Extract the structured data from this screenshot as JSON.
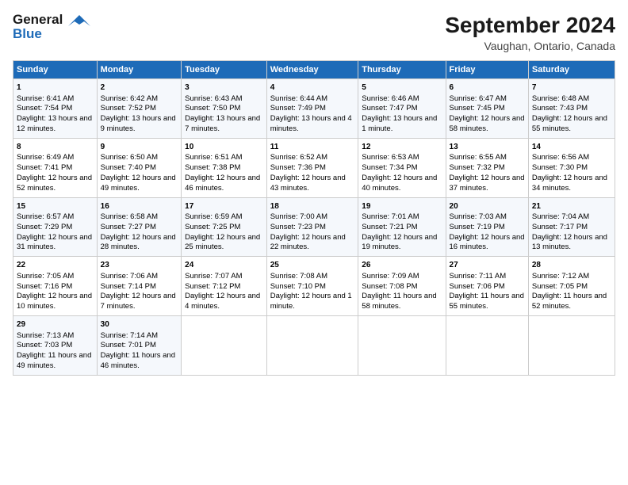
{
  "logo": {
    "line1": "General",
    "line2": "Blue"
  },
  "title": "September 2024",
  "subtitle": "Vaughan, Ontario, Canada",
  "headers": [
    "Sunday",
    "Monday",
    "Tuesday",
    "Wednesday",
    "Thursday",
    "Friday",
    "Saturday"
  ],
  "weeks": [
    [
      {
        "day": "1",
        "sunrise": "Sunrise: 6:41 AM",
        "sunset": "Sunset: 7:54 PM",
        "daylight": "Daylight: 13 hours and 12 minutes."
      },
      {
        "day": "2",
        "sunrise": "Sunrise: 6:42 AM",
        "sunset": "Sunset: 7:52 PM",
        "daylight": "Daylight: 13 hours and 9 minutes."
      },
      {
        "day": "3",
        "sunrise": "Sunrise: 6:43 AM",
        "sunset": "Sunset: 7:50 PM",
        "daylight": "Daylight: 13 hours and 7 minutes."
      },
      {
        "day": "4",
        "sunrise": "Sunrise: 6:44 AM",
        "sunset": "Sunset: 7:49 PM",
        "daylight": "Daylight: 13 hours and 4 minutes."
      },
      {
        "day": "5",
        "sunrise": "Sunrise: 6:46 AM",
        "sunset": "Sunset: 7:47 PM",
        "daylight": "Daylight: 13 hours and 1 minute."
      },
      {
        "day": "6",
        "sunrise": "Sunrise: 6:47 AM",
        "sunset": "Sunset: 7:45 PM",
        "daylight": "Daylight: 12 hours and 58 minutes."
      },
      {
        "day": "7",
        "sunrise": "Sunrise: 6:48 AM",
        "sunset": "Sunset: 7:43 PM",
        "daylight": "Daylight: 12 hours and 55 minutes."
      }
    ],
    [
      {
        "day": "8",
        "sunrise": "Sunrise: 6:49 AM",
        "sunset": "Sunset: 7:41 PM",
        "daylight": "Daylight: 12 hours and 52 minutes."
      },
      {
        "day": "9",
        "sunrise": "Sunrise: 6:50 AM",
        "sunset": "Sunset: 7:40 PM",
        "daylight": "Daylight: 12 hours and 49 minutes."
      },
      {
        "day": "10",
        "sunrise": "Sunrise: 6:51 AM",
        "sunset": "Sunset: 7:38 PM",
        "daylight": "Daylight: 12 hours and 46 minutes."
      },
      {
        "day": "11",
        "sunrise": "Sunrise: 6:52 AM",
        "sunset": "Sunset: 7:36 PM",
        "daylight": "Daylight: 12 hours and 43 minutes."
      },
      {
        "day": "12",
        "sunrise": "Sunrise: 6:53 AM",
        "sunset": "Sunset: 7:34 PM",
        "daylight": "Daylight: 12 hours and 40 minutes."
      },
      {
        "day": "13",
        "sunrise": "Sunrise: 6:55 AM",
        "sunset": "Sunset: 7:32 PM",
        "daylight": "Daylight: 12 hours and 37 minutes."
      },
      {
        "day": "14",
        "sunrise": "Sunrise: 6:56 AM",
        "sunset": "Sunset: 7:30 PM",
        "daylight": "Daylight: 12 hours and 34 minutes."
      }
    ],
    [
      {
        "day": "15",
        "sunrise": "Sunrise: 6:57 AM",
        "sunset": "Sunset: 7:29 PM",
        "daylight": "Daylight: 12 hours and 31 minutes."
      },
      {
        "day": "16",
        "sunrise": "Sunrise: 6:58 AM",
        "sunset": "Sunset: 7:27 PM",
        "daylight": "Daylight: 12 hours and 28 minutes."
      },
      {
        "day": "17",
        "sunrise": "Sunrise: 6:59 AM",
        "sunset": "Sunset: 7:25 PM",
        "daylight": "Daylight: 12 hours and 25 minutes."
      },
      {
        "day": "18",
        "sunrise": "Sunrise: 7:00 AM",
        "sunset": "Sunset: 7:23 PM",
        "daylight": "Daylight: 12 hours and 22 minutes."
      },
      {
        "day": "19",
        "sunrise": "Sunrise: 7:01 AM",
        "sunset": "Sunset: 7:21 PM",
        "daylight": "Daylight: 12 hours and 19 minutes."
      },
      {
        "day": "20",
        "sunrise": "Sunrise: 7:03 AM",
        "sunset": "Sunset: 7:19 PM",
        "daylight": "Daylight: 12 hours and 16 minutes."
      },
      {
        "day": "21",
        "sunrise": "Sunrise: 7:04 AM",
        "sunset": "Sunset: 7:17 PM",
        "daylight": "Daylight: 12 hours and 13 minutes."
      }
    ],
    [
      {
        "day": "22",
        "sunrise": "Sunrise: 7:05 AM",
        "sunset": "Sunset: 7:16 PM",
        "daylight": "Daylight: 12 hours and 10 minutes."
      },
      {
        "day": "23",
        "sunrise": "Sunrise: 7:06 AM",
        "sunset": "Sunset: 7:14 PM",
        "daylight": "Daylight: 12 hours and 7 minutes."
      },
      {
        "day": "24",
        "sunrise": "Sunrise: 7:07 AM",
        "sunset": "Sunset: 7:12 PM",
        "daylight": "Daylight: 12 hours and 4 minutes."
      },
      {
        "day": "25",
        "sunrise": "Sunrise: 7:08 AM",
        "sunset": "Sunset: 7:10 PM",
        "daylight": "Daylight: 12 hours and 1 minute."
      },
      {
        "day": "26",
        "sunrise": "Sunrise: 7:09 AM",
        "sunset": "Sunset: 7:08 PM",
        "daylight": "Daylight: 11 hours and 58 minutes."
      },
      {
        "day": "27",
        "sunrise": "Sunrise: 7:11 AM",
        "sunset": "Sunset: 7:06 PM",
        "daylight": "Daylight: 11 hours and 55 minutes."
      },
      {
        "day": "28",
        "sunrise": "Sunrise: 7:12 AM",
        "sunset": "Sunset: 7:05 PM",
        "daylight": "Daylight: 11 hours and 52 minutes."
      }
    ],
    [
      {
        "day": "29",
        "sunrise": "Sunrise: 7:13 AM",
        "sunset": "Sunset: 7:03 PM",
        "daylight": "Daylight: 11 hours and 49 minutes."
      },
      {
        "day": "30",
        "sunrise": "Sunrise: 7:14 AM",
        "sunset": "Sunset: 7:01 PM",
        "daylight": "Daylight: 11 hours and 46 minutes."
      },
      null,
      null,
      null,
      null,
      null
    ]
  ]
}
